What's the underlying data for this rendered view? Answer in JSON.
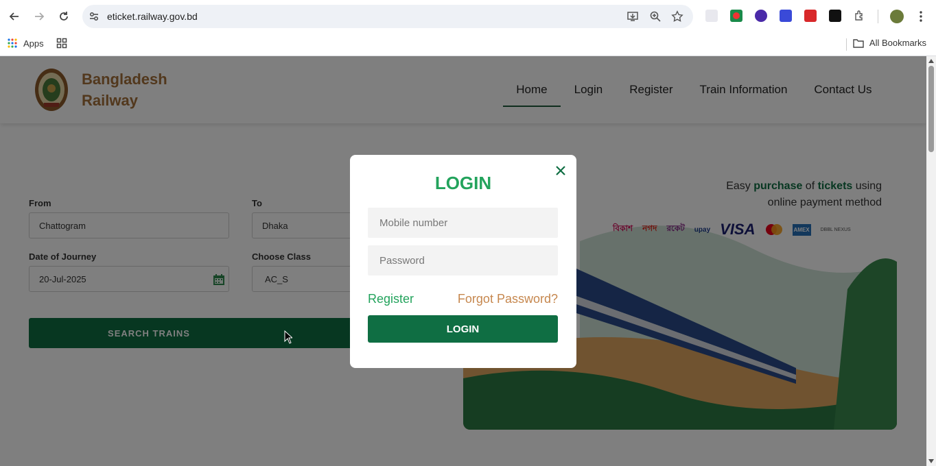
{
  "browser": {
    "url": "eticket.railway.gov.bd",
    "bookmarks": {
      "apps_label": "Apps",
      "all_bookmarks_label": "All Bookmarks"
    }
  },
  "header": {
    "brand_line1": "Bangladesh",
    "brand_line2": "Railway",
    "nav": [
      {
        "label": "Home",
        "active": true
      },
      {
        "label": "Login"
      },
      {
        "label": "Register"
      },
      {
        "label": "Train Information"
      },
      {
        "label": "Contact Us"
      }
    ]
  },
  "search_form": {
    "from_label": "From",
    "from_value": "Chattogram",
    "to_label": "To",
    "to_value": "Dhaka",
    "date_label": "Date of Journey",
    "date_value": "20-Jul-2025",
    "class_label": "Choose Class",
    "class_value": "AC_S",
    "search_button": "SEARCH TRAINS"
  },
  "promo": {
    "pre": "Easy ",
    "purchase": "purchase",
    "mid": " of ",
    "tickets": "tickets",
    "post": " using",
    "line2": "online payment method",
    "payment_methods": [
      "বিকাশ",
      "নগদ",
      "রকেট",
      "upay",
      "VISA",
      "Mastercard",
      "AMEX",
      "DBBL NEXUS"
    ]
  },
  "login_modal": {
    "title": "LOGIN",
    "mobile_placeholder": "Mobile number",
    "password_placeholder": "Password",
    "register_link": "Register",
    "forgot_link": "Forgot Password?",
    "login_button": "LOGIN"
  }
}
